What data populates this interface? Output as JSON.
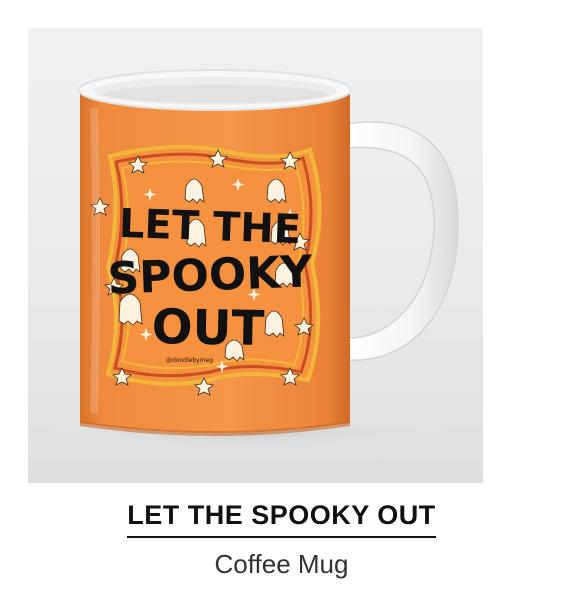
{
  "product": {
    "title": "LET THE SPOOKY OUT",
    "type": "Coffee Mug",
    "image_alt": "Let The Spooky Out coffee mug",
    "mug_color": "#f08a3e",
    "artwork": {
      "lines": [
        "LET THE",
        "SPOOKY",
        "OUT"
      ],
      "signature": "@doodlebymeg"
    }
  }
}
